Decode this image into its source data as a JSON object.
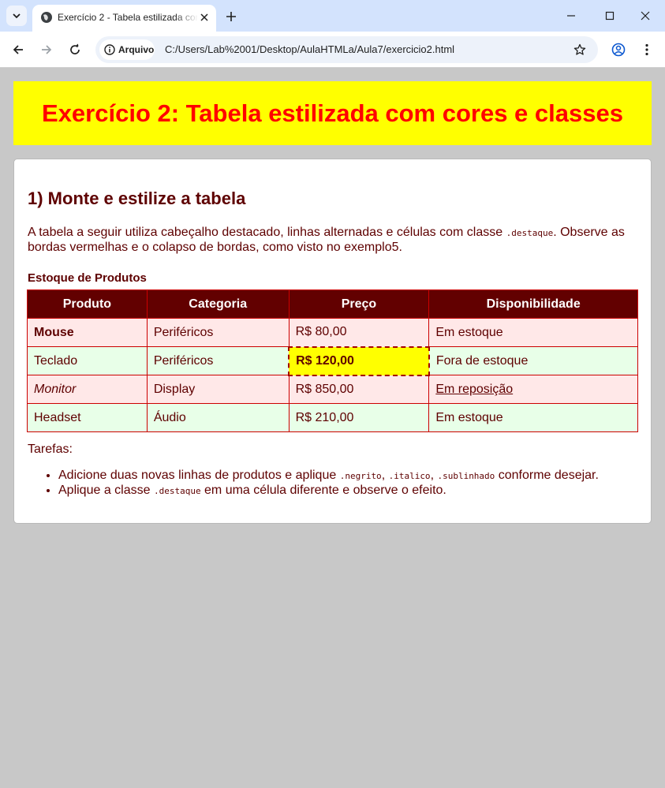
{
  "browser": {
    "tab_title": "Exercício 2 - Tabela estilizada com cores e classes",
    "site_chip": "Arquivo",
    "url": "C:/Users/Lab%2001/Desktop/AulaHTMLa/Aula7/exercicio2.html"
  },
  "page": {
    "banner_title": "Exercício 2: Tabela estilizada com cores e classes",
    "section_title": "1) Monte e estilize a tabela",
    "intro": {
      "before": "A tabela a seguir utiliza cabeçalho destacado, linhas alternadas e células com classe ",
      "code": ".destaque",
      "after": ". Observe as bordas vermelhas e o colapso de bordas, como visto no exemplo5."
    },
    "table_caption": "Estoque de Produtos",
    "table": {
      "headers": [
        "Produto",
        "Categoria",
        "Preço",
        "Disponibilidade"
      ],
      "rows": [
        [
          "Mouse",
          "Periféricos",
          "R$ 80,00",
          "Em estoque"
        ],
        [
          "Teclado",
          "Periféricos",
          "R$ 120,00",
          "Fora de estoque"
        ],
        [
          "Monitor",
          "Display",
          "R$ 850,00",
          "Em reposição"
        ],
        [
          "Headset",
          "Áudio",
          "R$ 210,00",
          "Em estoque"
        ]
      ]
    },
    "tasks_title": "Tarefas:",
    "tasks": [
      {
        "t1": "Adicione duas novas linhas de produtos e aplique ",
        "c1": ".negrito",
        "t2": ", ",
        "c2": ".italico",
        "t3": ", ",
        "c3": ".sublinhado",
        "t4": " conforme desejar."
      },
      {
        "t1": "Aplique a classe ",
        "c1": ".destaque",
        "t2": " em uma célula diferente e observe o efeito."
      }
    ]
  },
  "colors": {
    "banner_bg": "#ffff00",
    "banner_text": "#ff0000",
    "text": "#5e0000",
    "header_bg": "#620000",
    "row_odd": "#ffe8e8",
    "row_even": "#e8ffe8",
    "border": "#cc0000"
  }
}
